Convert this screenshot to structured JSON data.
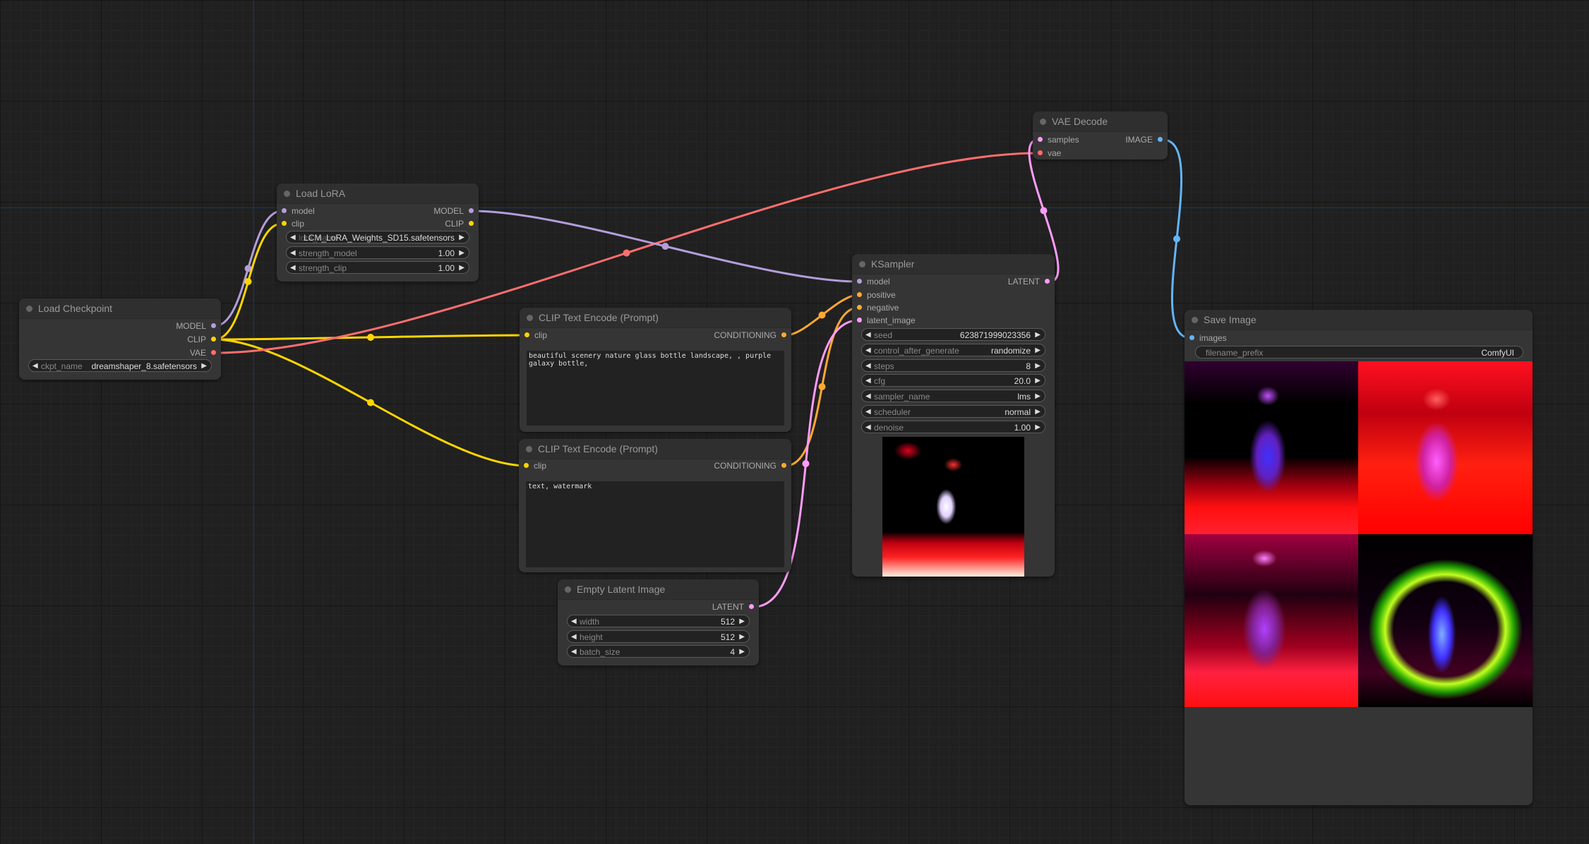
{
  "colors": {
    "model": "#b39ddb",
    "clip": "#ffd500",
    "vae": "#ff6e6e",
    "conditioning": "#ffa931",
    "latent": "#ff9cf9",
    "image": "#64b5f6"
  },
  "nodes": {
    "load_checkpoint": {
      "title": "Load Checkpoint",
      "outputs": [
        "MODEL",
        "CLIP",
        "VAE"
      ],
      "widgets": [
        {
          "label": "ckpt_name",
          "value": "dreamshaper_8.safetensors"
        }
      ]
    },
    "load_lora": {
      "title": "Load LoRA",
      "inputs": [
        "model",
        "clip"
      ],
      "outputs": [
        "MODEL",
        "CLIP"
      ],
      "widgets": [
        {
          "label": "lora_name",
          "value": "LCM_LoRA_Weights_SD15.safetensors"
        },
        {
          "label": "strength_model",
          "value": "1.00"
        },
        {
          "label": "strength_clip",
          "value": "1.00"
        }
      ]
    },
    "clip_positive": {
      "title": "CLIP Text Encode (Prompt)",
      "inputs": [
        "clip"
      ],
      "outputs": [
        "CONDITIONING"
      ],
      "text": "beautiful scenery nature glass bottle landscape, , purple galaxy bottle,"
    },
    "clip_negative": {
      "title": "CLIP Text Encode (Prompt)",
      "inputs": [
        "clip"
      ],
      "outputs": [
        "CONDITIONING"
      ],
      "text": "text, watermark"
    },
    "empty_latent": {
      "title": "Empty Latent Image",
      "outputs": [
        "LATENT"
      ],
      "widgets": [
        {
          "label": "width",
          "value": "512"
        },
        {
          "label": "height",
          "value": "512"
        },
        {
          "label": "batch_size",
          "value": "4"
        }
      ]
    },
    "ksampler": {
      "title": "KSampler",
      "inputs": [
        "model",
        "positive",
        "negative",
        "latent_image"
      ],
      "outputs": [
        "LATENT"
      ],
      "widgets": [
        {
          "label": "seed",
          "value": "623871999023356"
        },
        {
          "label": "control_after_generate",
          "value": "randomize"
        },
        {
          "label": "steps",
          "value": "8"
        },
        {
          "label": "cfg",
          "value": "20.0"
        },
        {
          "label": "sampler_name",
          "value": "lms"
        },
        {
          "label": "scheduler",
          "value": "normal"
        },
        {
          "label": "denoise",
          "value": "1.00"
        }
      ]
    },
    "vae_decode": {
      "title": "VAE Decode",
      "inputs": [
        "samples",
        "vae"
      ],
      "outputs": [
        "IMAGE"
      ]
    },
    "save_image": {
      "title": "Save Image",
      "inputs": [
        "images"
      ],
      "widgets": [
        {
          "label": "filename_prefix",
          "value": "ComfyUI"
        }
      ]
    }
  }
}
